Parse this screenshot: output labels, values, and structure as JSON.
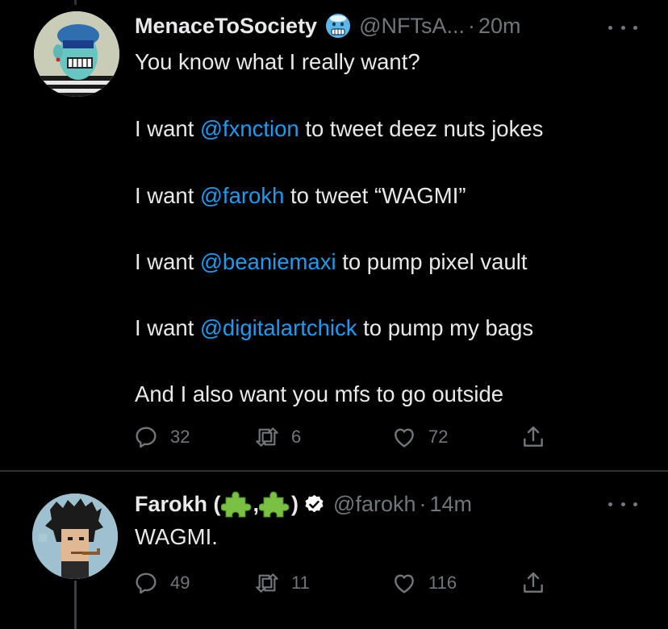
{
  "tweets": [
    {
      "author_name": "MenaceToSociety",
      "handle": "@NFTsA...",
      "separator": "·",
      "time": "20m",
      "lines": [
        [
          "You know what I really want?"
        ],
        [
          "I want ",
          "@fxnction",
          " to tweet deez nuts jokes"
        ],
        [
          "I want ",
          "@farokh",
          " to tweet “WAGMI”"
        ],
        [
          "I want ",
          "@beaniemaxi",
          " to pump pixel vault"
        ],
        [
          "I want ",
          "@digitalartchick",
          " to pump my bags"
        ],
        [
          "And I also want you mfs to go outside"
        ]
      ],
      "replies": "32",
      "retweets": "6",
      "likes": "72"
    },
    {
      "author_name": "Farokh (",
      "name_sep": ",",
      "name_close": ")",
      "handle": "@farokh",
      "separator": "·",
      "time": "14m",
      "text": "WAGMI.",
      "replies": "49",
      "retweets": "11",
      "likes": "116"
    }
  ],
  "colors": {
    "background": "#000000",
    "text": "#e7e9ea",
    "muted": "#71767b",
    "link": "#1d9bf0",
    "divider": "#2f3336"
  },
  "icons": [
    "cold-face-emoji-icon",
    "puzzle-piece-icon",
    "verified-badge-icon",
    "more-icon",
    "reply-icon",
    "retweet-icon",
    "like-icon",
    "share-icon"
  ]
}
